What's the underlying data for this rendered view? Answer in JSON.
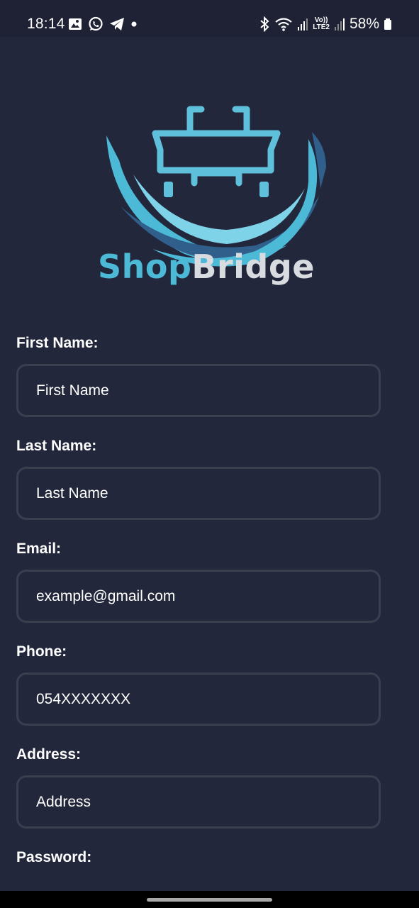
{
  "status_bar": {
    "time": "18:14",
    "left_icons": [
      "image-icon",
      "whatsapp-icon",
      "telegram-icon",
      "dot-icon"
    ],
    "right_icons": [
      "bluetooth-icon",
      "wifi-icon",
      "signal-icon",
      "volte-icon",
      "signal-icon"
    ],
    "volte_label": "Vo))",
    "lte_label": "LTE2",
    "battery": "58%"
  },
  "brand": {
    "logo_icon": "shopping-cart-bridge-icon",
    "name_part1": "Shop",
    "name_part2": "Bridge",
    "colors": {
      "primary": "#4cbad6",
      "secondary": "#d8dbe0",
      "accent_dark": "#2f5f8a"
    }
  },
  "form": {
    "fields": [
      {
        "label": "First Name:",
        "placeholder": "First Name"
      },
      {
        "label": "Last Name:",
        "placeholder": "Last Name"
      },
      {
        "label": "Email:",
        "placeholder": "example@gmail.com"
      },
      {
        "label": "Phone:",
        "placeholder": "054XXXXXXX"
      },
      {
        "label": "Address:",
        "placeholder": "Address"
      },
      {
        "label": "Password:",
        "placeholder": ""
      }
    ]
  },
  "theme": {
    "background": "#23273b",
    "input_border": "#3a3f50",
    "text": "#ffffff"
  }
}
